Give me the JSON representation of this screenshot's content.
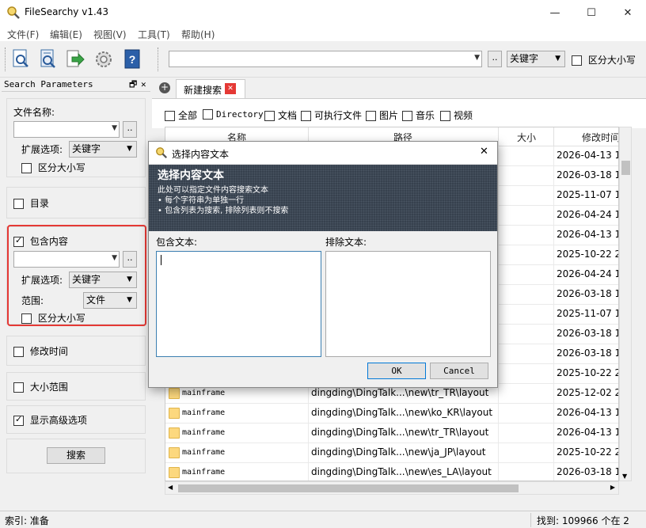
{
  "app": {
    "title": "FileSearchy v1.43"
  },
  "window_controls": {
    "minimize": "—",
    "maximize": "☐",
    "close": "✕"
  },
  "menu": [
    "文件(F)",
    "编辑(E)",
    "视图(V)",
    "工具(T)",
    "帮助(H)"
  ],
  "toolbar": {
    "search_value": "",
    "browse_label": "..",
    "mode_value": "关键字",
    "case_label": "区分大小写"
  },
  "panel": {
    "title": "Search Parameters",
    "pin_icon": "🗗",
    "close_icon": "✕",
    "filename_label": "文件名称:",
    "filename_value": "",
    "ext_label": "扩展选项:",
    "ext_value": "关键字",
    "case1_label": "区分大小写",
    "dir_label": "目录",
    "content_label": "包含内容",
    "content_value": "",
    "content_ext_label": "扩展选项:",
    "content_ext_value": "关键字",
    "scope_label": "范围:",
    "scope_value": "文件",
    "case2_label": "区分大小写",
    "modtime_label": "修改时间",
    "size_label": "大小范围",
    "advanced_label": "显示高级选项",
    "search_button": "搜索",
    "browse_label": ".."
  },
  "tabs": {
    "add_icon": "+",
    "active_tab": "新建搜索",
    "close_icon": "✕"
  },
  "filters": [
    "全部",
    "Directory",
    "文档",
    "可执行文件",
    "图片",
    "音乐",
    "视频"
  ],
  "grid": {
    "columns": [
      "名称",
      "路径",
      "大小",
      "修改时间"
    ],
    "rows": [
      {
        "name": "",
        "path": "",
        "size": "",
        "date": "2026-04-13 1("
      },
      {
        "name": "",
        "path": "",
        "size": "",
        "date": "2026-03-18 14"
      },
      {
        "name": "",
        "path": "",
        "size": "",
        "date": "2025-11-07 1"
      },
      {
        "name": "",
        "path": "",
        "size": "",
        "date": "2026-04-24 16"
      },
      {
        "name": "",
        "path": "",
        "size": "",
        "date": "2026-04-13 16"
      },
      {
        "name": "",
        "path": "",
        "size": "",
        "date": "2025-10-22 2("
      },
      {
        "name": "",
        "path": "",
        "size": "",
        "date": "2026-04-24 16"
      },
      {
        "name": "",
        "path": "",
        "size": "",
        "date": "2026-03-18 14"
      },
      {
        "name": "",
        "path": "",
        "size": "",
        "date": "2025-11-07 1"
      },
      {
        "name": "",
        "path": "",
        "size": "",
        "date": "2026-03-18 14"
      },
      {
        "name": "",
        "path": "",
        "size": "",
        "date": "2026-03-18 14"
      },
      {
        "name": "",
        "path": "",
        "size": "",
        "date": "2025-10-22 2("
      },
      {
        "name": "mainframe",
        "path": "dingding\\DingTalk...\\new\\tr_TR\\layout",
        "size": "",
        "date": "2025-12-02 2("
      },
      {
        "name": "mainframe",
        "path": "dingding\\DingTalk...\\new\\ko_KR\\layout",
        "size": "",
        "date": "2026-04-13 16"
      },
      {
        "name": "mainframe",
        "path": "dingding\\DingTalk...\\new\\tr_TR\\layout",
        "size": "",
        "date": "2026-04-13 16"
      },
      {
        "name": "mainframe",
        "path": "dingding\\DingTalk...\\new\\ja_JP\\layout",
        "size": "",
        "date": "2025-10-22 2("
      },
      {
        "name": "mainframe",
        "path": "dingding\\DingTalk...\\new\\es_LA\\layout",
        "size": "",
        "date": "2026-03-18 14"
      }
    ]
  },
  "status": {
    "left": "索引: 准备",
    "right": "找到: 109966 个在 2"
  },
  "dialog": {
    "title": "选择内容文本",
    "close_icon": "✕",
    "banner_title": "选择内容文本",
    "banner_line1": "此处可以指定文件内容搜索文本",
    "banner_line2": "• 每个字符串为单独一行",
    "banner_line3": "• 包含列表为搜索, 排除列表则不搜索",
    "include_label": "包含文本:",
    "exclude_label": "排除文本:",
    "include_value": "",
    "exclude_value": "",
    "ok_label": "OK",
    "cancel_label": "Cancel"
  }
}
